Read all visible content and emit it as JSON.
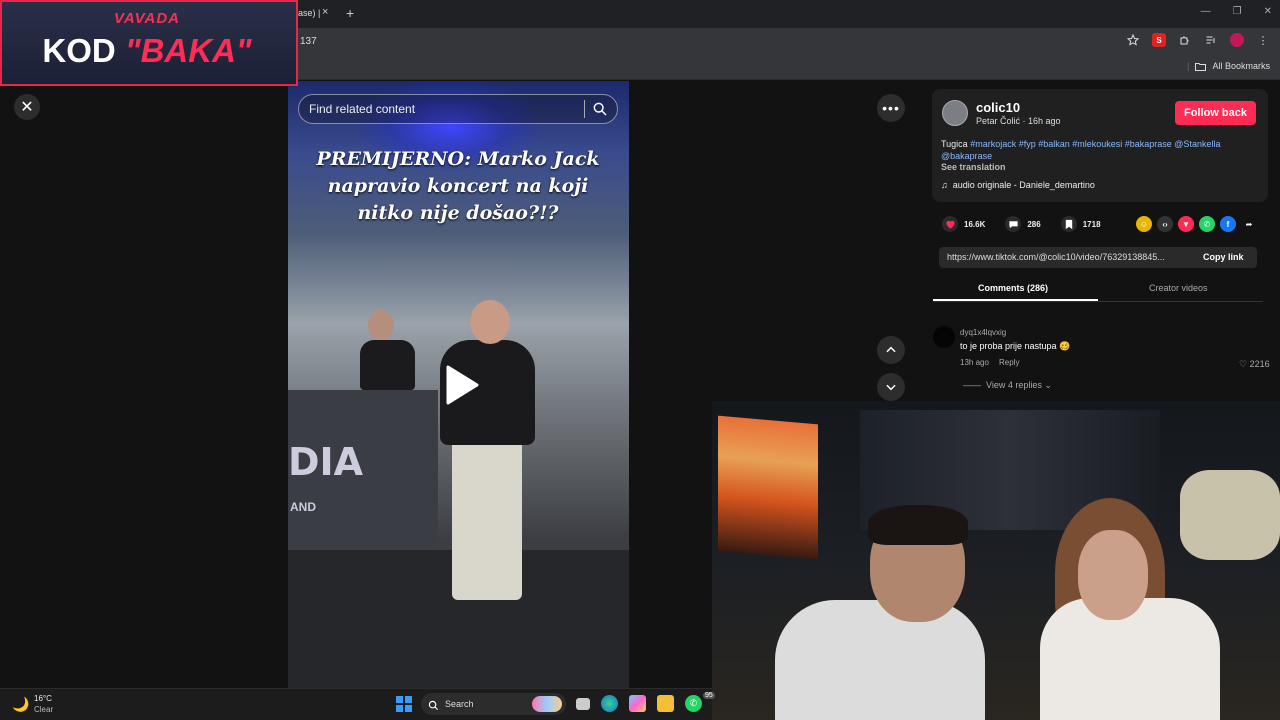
{
  "browser": {
    "tab_title": "ase) |",
    "tab_close": "×",
    "new_tab": "+",
    "url": "137",
    "bookmarks_label": "All Bookmarks",
    "window_controls": [
      "—",
      "❐",
      "✕"
    ]
  },
  "overlay_logo": {
    "brand": "VAVADA",
    "code_prefix": "KOD",
    "code_word": "\"BAKA\""
  },
  "video": {
    "search_placeholder": "Find related content",
    "caption": "PREMIJERNO: Marko Jack napravio koncert na koji nitko nije došao?!?",
    "stage_brand": "DIA",
    "stage_brand_sub": "AND"
  },
  "post": {
    "username": "colic10",
    "author_line": "Petar Čolić · 16h ago",
    "follow_label": "Follow back",
    "description_prefix": "Tugica ",
    "hashtags": "#markojack #fyp #balkan #mlekoukesi #bakaprase @Stankella @bakaprase",
    "see_translation": "See translation",
    "music": "audio originale - Daniele_demartino",
    "likes": "16.6K",
    "comments_count": "286",
    "saves": "1718",
    "link": "https://www.tiktok.com/@colic10/video/76329138845...",
    "copy_link_label": "Copy link",
    "tab_comments": "Comments (286)",
    "tab_creator": "Creator videos"
  },
  "comment": {
    "user": "dyq1x4lqvxig",
    "text": "to je proba prije nastupa 🥴",
    "time": "13h ago",
    "reply_label": "Reply",
    "likes": "2216",
    "view_replies": "View 4 replies"
  },
  "taskbar": {
    "temperature": "16°C",
    "weather": "Clear",
    "search_label": "Search",
    "whatsapp_badge": "95"
  },
  "colors": {
    "accent": "#fe2c55",
    "logo_red": "#ff2d55",
    "hashtag": "#8ab8ff"
  }
}
